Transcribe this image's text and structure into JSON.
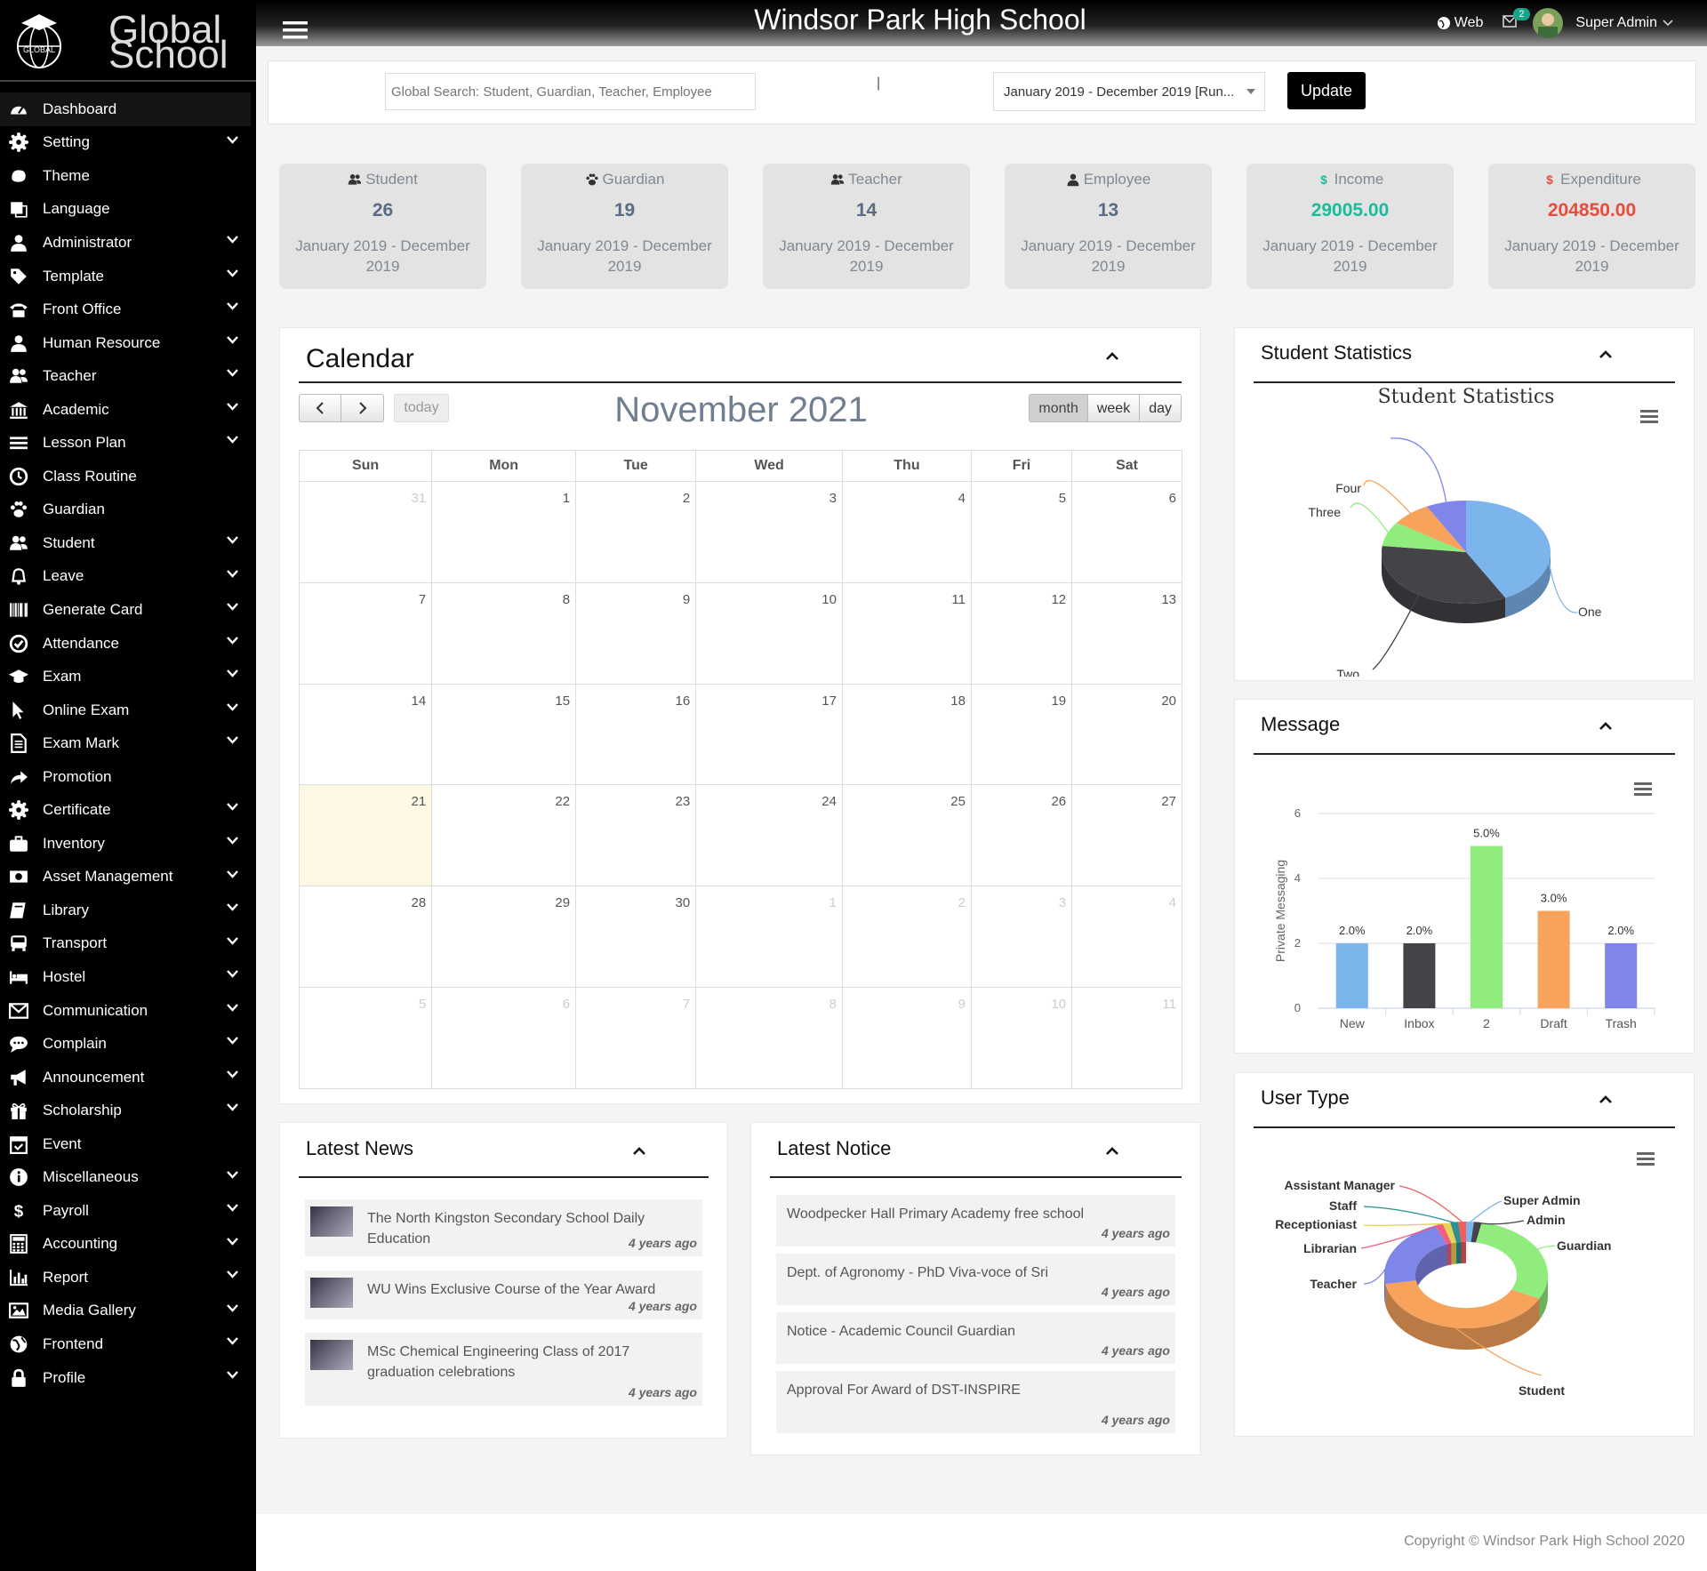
{
  "brand": {
    "logo_text": "GLOBAL",
    "line1": "Global",
    "line2": "School"
  },
  "header": {
    "school_name": "Windsor Park High School",
    "web_label": "Web",
    "notifications_count": "2",
    "user_name": "Super Admin"
  },
  "sidebar": {
    "items": [
      {
        "label": "Dashboard",
        "icon": "dashboard-icon",
        "arrow": false
      },
      {
        "label": "Setting",
        "icon": "gears-icon",
        "arrow": true
      },
      {
        "label": "Theme",
        "icon": "paint-icon",
        "arrow": false
      },
      {
        "label": "Language",
        "icon": "language-icon",
        "arrow": false
      },
      {
        "label": "Administrator",
        "icon": "user-icon",
        "arrow": true
      },
      {
        "label": "Template",
        "icon": "tags-icon",
        "arrow": true
      },
      {
        "label": "Front Office",
        "icon": "phone-icon",
        "arrow": true
      },
      {
        "label": "Human Resource",
        "icon": "user-md-icon",
        "arrow": true
      },
      {
        "label": "Teacher",
        "icon": "users-icon",
        "arrow": true
      },
      {
        "label": "Academic",
        "icon": "institution-icon",
        "arrow": true
      },
      {
        "label": "Lesson Plan",
        "icon": "list-icon",
        "arrow": true
      },
      {
        "label": "Class Routine",
        "icon": "clock-icon",
        "arrow": false
      },
      {
        "label": "Guardian",
        "icon": "paw-icon",
        "arrow": false
      },
      {
        "label": "Student",
        "icon": "users-icon",
        "arrow": true
      },
      {
        "label": "Leave",
        "icon": "bell-icon",
        "arrow": true
      },
      {
        "label": "Generate Card",
        "icon": "barcode-icon",
        "arrow": true
      },
      {
        "label": "Attendance",
        "icon": "check-circle-icon",
        "arrow": true
      },
      {
        "label": "Exam",
        "icon": "graduation-cap-icon",
        "arrow": true
      },
      {
        "label": "Online Exam",
        "icon": "mouse-pointer-icon",
        "arrow": true
      },
      {
        "label": "Exam Mark",
        "icon": "file-text-icon",
        "arrow": true
      },
      {
        "label": "Promotion",
        "icon": "share-icon",
        "arrow": false
      },
      {
        "label": "Certificate",
        "icon": "certificate-icon",
        "arrow": true
      },
      {
        "label": "Inventory",
        "icon": "briefcase-icon",
        "arrow": true
      },
      {
        "label": "Asset Management",
        "icon": "money-icon",
        "arrow": true
      },
      {
        "label": "Library",
        "icon": "book-icon",
        "arrow": true
      },
      {
        "label": "Transport",
        "icon": "bus-icon",
        "arrow": true
      },
      {
        "label": "Hostel",
        "icon": "bed-icon",
        "arrow": true
      },
      {
        "label": "Communication",
        "icon": "envelope-icon",
        "arrow": true
      },
      {
        "label": "Complain",
        "icon": "comment-icon",
        "arrow": true
      },
      {
        "label": "Announcement",
        "icon": "bullhorn-icon",
        "arrow": true
      },
      {
        "label": "Scholarship",
        "icon": "gift-icon",
        "arrow": true
      },
      {
        "label": "Event",
        "icon": "calendar-check-icon",
        "arrow": false
      },
      {
        "label": "Miscellaneous",
        "icon": "info-circle-icon",
        "arrow": true
      },
      {
        "label": "Payroll",
        "icon": "dollar-icon",
        "arrow": true
      },
      {
        "label": "Accounting",
        "icon": "calculator-icon",
        "arrow": true
      },
      {
        "label": "Report",
        "icon": "bar-chart-icon",
        "arrow": true
      },
      {
        "label": "Media Gallery",
        "icon": "image-icon",
        "arrow": true
      },
      {
        "label": "Frontend",
        "icon": "globe-icon",
        "arrow": true
      },
      {
        "label": "Profile",
        "icon": "lock-icon",
        "arrow": true
      }
    ]
  },
  "search": {
    "placeholder": "Global Search: Student, Guardian, Teacher, Employee",
    "session": "January 2019 - December 2019 [Run...",
    "update_label": "Update"
  },
  "stats": [
    {
      "title": "Student",
      "icon": "users-icon",
      "value": "26",
      "period": "January 2019 - December 2019",
      "color": "#5b6b80"
    },
    {
      "title": "Guardian",
      "icon": "paw-icon",
      "value": "19",
      "period": "January 2019 - December 2019",
      "color": "#5b6b80"
    },
    {
      "title": "Teacher",
      "icon": "users-icon",
      "value": "14",
      "period": "January 2019 - December 2019",
      "color": "#5b6b80"
    },
    {
      "title": "Employee",
      "icon": "user-md-icon",
      "value": "13",
      "period": "January 2019 - December 2019",
      "color": "#5b6b80"
    },
    {
      "title": "Income",
      "icon": "dollar-icon",
      "value": "29005.00",
      "period": "January 2019 - December 2019",
      "color": "#1abc9c"
    },
    {
      "title": "Expenditure",
      "icon": "dollar-icon",
      "value": "204850.00",
      "period": "January 2019 - December 2019",
      "color": "#e74c3c"
    }
  ],
  "calendar": {
    "panel_title": "Calendar",
    "month_title": "November 2021",
    "today_label": "today",
    "views": [
      "month",
      "week",
      "day"
    ],
    "active_view": "month",
    "weekdays": [
      "Sun",
      "Mon",
      "Tue",
      "Wed",
      "Thu",
      "Fri",
      "Sat"
    ],
    "weeks": [
      [
        {
          "d": "31",
          "o": true
        },
        {
          "d": "1"
        },
        {
          "d": "2"
        },
        {
          "d": "3"
        },
        {
          "d": "4"
        },
        {
          "d": "5"
        },
        {
          "d": "6"
        }
      ],
      [
        {
          "d": "7"
        },
        {
          "d": "8"
        },
        {
          "d": "9"
        },
        {
          "d": "10"
        },
        {
          "d": "11"
        },
        {
          "d": "12"
        },
        {
          "d": "13"
        }
      ],
      [
        {
          "d": "14"
        },
        {
          "d": "15"
        },
        {
          "d": "16"
        },
        {
          "d": "17"
        },
        {
          "d": "18"
        },
        {
          "d": "19"
        },
        {
          "d": "20"
        }
      ],
      [
        {
          "d": "21",
          "t": true
        },
        {
          "d": "22"
        },
        {
          "d": "23"
        },
        {
          "d": "24"
        },
        {
          "d": "25"
        },
        {
          "d": "26"
        },
        {
          "d": "27"
        }
      ],
      [
        {
          "d": "28"
        },
        {
          "d": "29"
        },
        {
          "d": "30"
        },
        {
          "d": "1",
          "o": true
        },
        {
          "d": "2",
          "o": true
        },
        {
          "d": "3",
          "o": true
        },
        {
          "d": "4",
          "o": true
        }
      ],
      [
        {
          "d": "5",
          "o": true
        },
        {
          "d": "6",
          "o": true
        },
        {
          "d": "7",
          "o": true
        },
        {
          "d": "8",
          "o": true
        },
        {
          "d": "9",
          "o": true
        },
        {
          "d": "10",
          "o": true
        },
        {
          "d": "11",
          "o": true
        }
      ]
    ]
  },
  "news": {
    "title": "Latest News",
    "items": [
      {
        "text": "The North Kingston Secondary School Daily Education",
        "ago": "4 years ago"
      },
      {
        "text": "WU Wins Exclusive Course of the Year Award",
        "ago": "4 years ago"
      },
      {
        "text": "MSc Chemical Engineering Class of 2017 graduation celebrations",
        "ago": "4 years ago"
      }
    ]
  },
  "notice": {
    "title": "Latest Notice",
    "items": [
      {
        "text": "Woodpecker Hall Primary Academy free school",
        "ago": "4 years ago"
      },
      {
        "text": "Dept. of Agronomy - PhD Viva-voce of Sri",
        "ago": "4 years ago"
      },
      {
        "text": "Notice - Academic Council Guardian",
        "ago": "4 years ago"
      },
      {
        "text": "Approval For Award of DST-INSPIRE",
        "ago": "4 years ago"
      }
    ]
  },
  "panels": {
    "student_statistics": "Student Statistics",
    "message": "Message",
    "user_type": "User Type"
  },
  "chart_data": [
    {
      "type": "pie",
      "title": "Student Statistics",
      "categories": [
        "One",
        "Two",
        "Three",
        "Four",
        ""
      ],
      "values": [
        11,
        9,
        2,
        2,
        2
      ],
      "colors": [
        "#7cb5ec",
        "#434348",
        "#90ed7d",
        "#f7a35c",
        "#8085e9"
      ]
    },
    {
      "type": "bar",
      "title": "",
      "categories": [
        "New",
        "Inbox",
        "2",
        "Draft",
        "Trash"
      ],
      "values": [
        2,
        2,
        5,
        3,
        2
      ],
      "data_labels": [
        "2.0%",
        "2.0%",
        "5.0%",
        "3.0%",
        "2.0%"
      ],
      "colors": [
        "#7cb5ec",
        "#434348",
        "#90ed7d",
        "#f7a35c",
        "#8085e9"
      ],
      "ylabel": "Private Messaging",
      "ylim": [
        0,
        6
      ],
      "yticks": [
        "0",
        "2",
        "4",
        "6"
      ]
    },
    {
      "type": "pie",
      "title": "",
      "categories": [
        "Super Admin",
        "Admin",
        "Guardian",
        "Student",
        "Teacher",
        "Librarian",
        "Receptioniast",
        "Staff",
        "Assistant Manager"
      ],
      "values": [
        1,
        1,
        19,
        26,
        14,
        1,
        1,
        1,
        1
      ],
      "colors": [
        "#7cb5ec",
        "#434348",
        "#90ed7d",
        "#f7a35c",
        "#8085e9",
        "#f15c80",
        "#e4d354",
        "#2b908f",
        "#f45b5b"
      ]
    }
  ],
  "footer": {
    "text": "Copyright © Windsor Park High School 2020"
  }
}
